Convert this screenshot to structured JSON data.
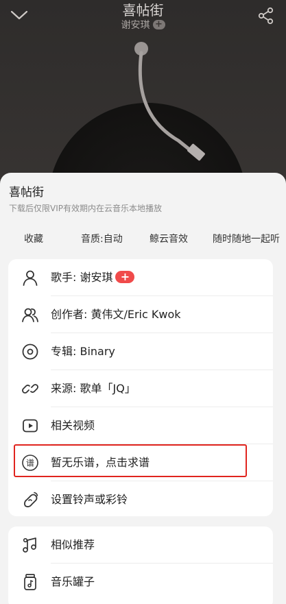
{
  "player": {
    "title": "喜帖街",
    "artist": "谢安琪",
    "follow_symbol": "+"
  },
  "sheet": {
    "title": "喜帖街",
    "note": "下载后仅限VIP有效期内在云音乐本地播放",
    "quick_actions": [
      "收藏",
      "音质:自动",
      "鲸云音效",
      "随时随地一起听"
    ],
    "menu_main": [
      {
        "label": "歌手: 谢安琪",
        "icon": "person-icon",
        "badge": "+"
      },
      {
        "label": "创作者: 黄伟文/Eric Kwok",
        "icon": "people-icon"
      },
      {
        "label": "专辑: Binary",
        "icon": "album-disc-icon"
      },
      {
        "label": "来源: 歌单「JQ」",
        "icon": "link-icon"
      },
      {
        "label": "相关视频",
        "icon": "video-play-icon"
      },
      {
        "label": "暂无乐谱，点击求谱",
        "icon": "sheet-music-icon"
      },
      {
        "label": "设置铃声或彩铃",
        "icon": "ringtone-icon"
      }
    ],
    "menu_more": [
      {
        "label": "相似推荐",
        "icon": "music-notes-icon"
      },
      {
        "label": "音乐罐子",
        "icon": "music-jar-icon"
      }
    ]
  },
  "colors": {
    "accent_red": "#f04a4a",
    "highlight_border": "#e0241e",
    "sheet_bg": "#f3f3f3",
    "card_bg": "#ffffff"
  }
}
